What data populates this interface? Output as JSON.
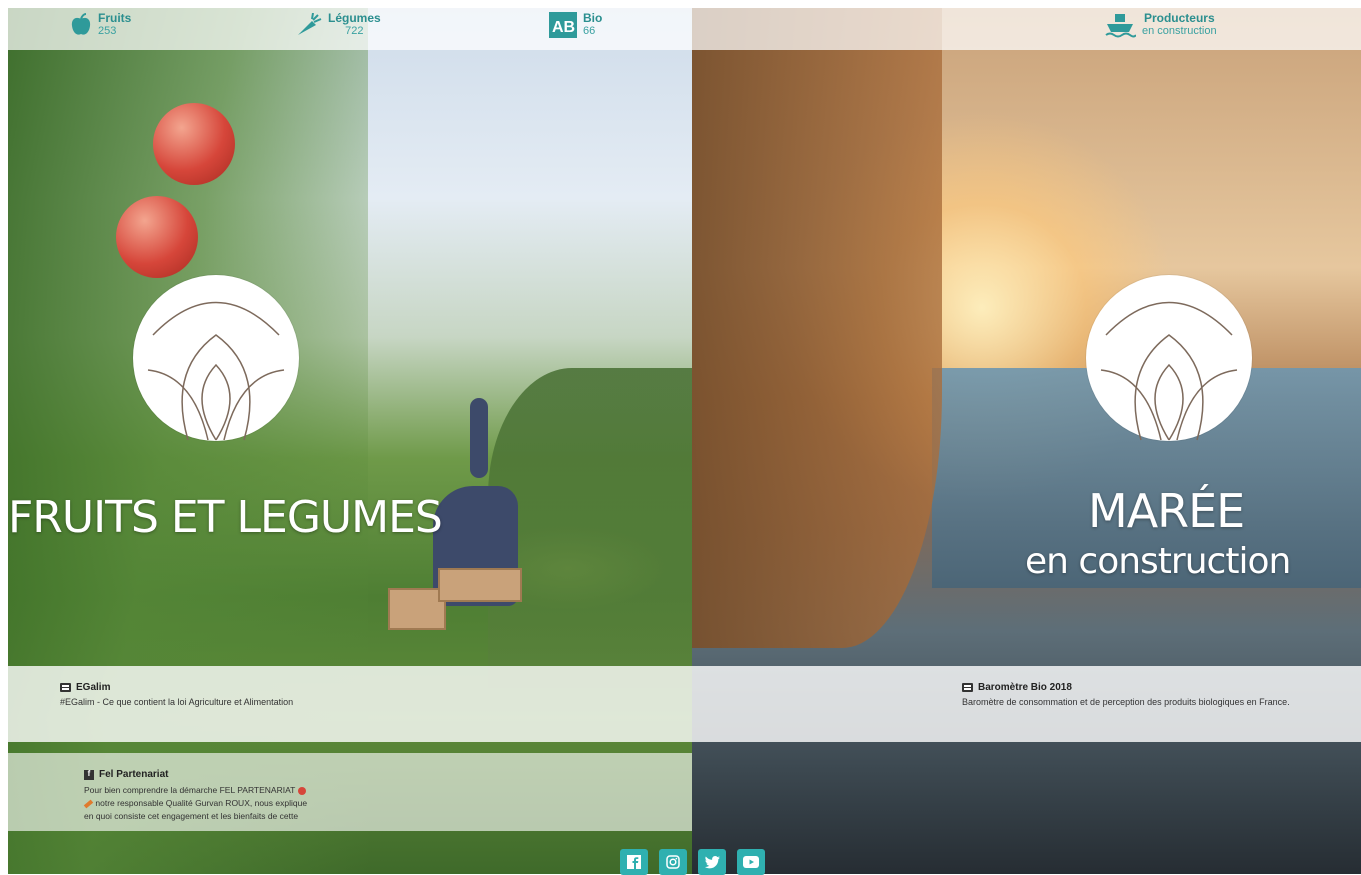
{
  "nav": {
    "fruits": {
      "label": "Fruits",
      "count": "253",
      "icon": "apple-icon"
    },
    "legumes": {
      "label": "Légumes",
      "count": "722",
      "icon": "carrot-icon"
    },
    "bio": {
      "label": "Bio",
      "count": "66",
      "icon": "ab-bio-icon"
    },
    "producteurs": {
      "label": "Producteurs",
      "sub": "en construction",
      "icon": "boat-icon"
    }
  },
  "sections": {
    "left_title": "FRUITS ET LEGUMES",
    "right_title": "MARÉE",
    "right_subtitle": "en construction"
  },
  "news": [
    {
      "title": "EGalim",
      "desc": "#EGalim - Ce que contient la loi Agriculture et Alimentation",
      "icon": "newspaper-icon"
    },
    {
      "title": "Baromètre Bio 2018",
      "desc": "Baromètre de consommation et de perception des produits biologiques en France.",
      "icon": "newspaper-icon"
    }
  ],
  "fel": {
    "title": "Fel Partenariat",
    "line1": "Pour bien comprendre la démarche FEL PARTENARIAT",
    "line2": "notre responsable Qualité Gurvan ROUX, nous explique",
    "line3": "en quoi consiste cet engagement et les bienfaits de cette",
    "icon": "facebook-icon"
  },
  "socials": [
    {
      "name": "facebook",
      "icon": "facebook-icon"
    },
    {
      "name": "instagram",
      "icon": "instagram-icon"
    },
    {
      "name": "twitter",
      "icon": "twitter-icon"
    },
    {
      "name": "youtube",
      "icon": "youtube-icon"
    }
  ],
  "colors": {
    "accent": "#2fb0b0",
    "nav_text": "#2b8f8f"
  }
}
